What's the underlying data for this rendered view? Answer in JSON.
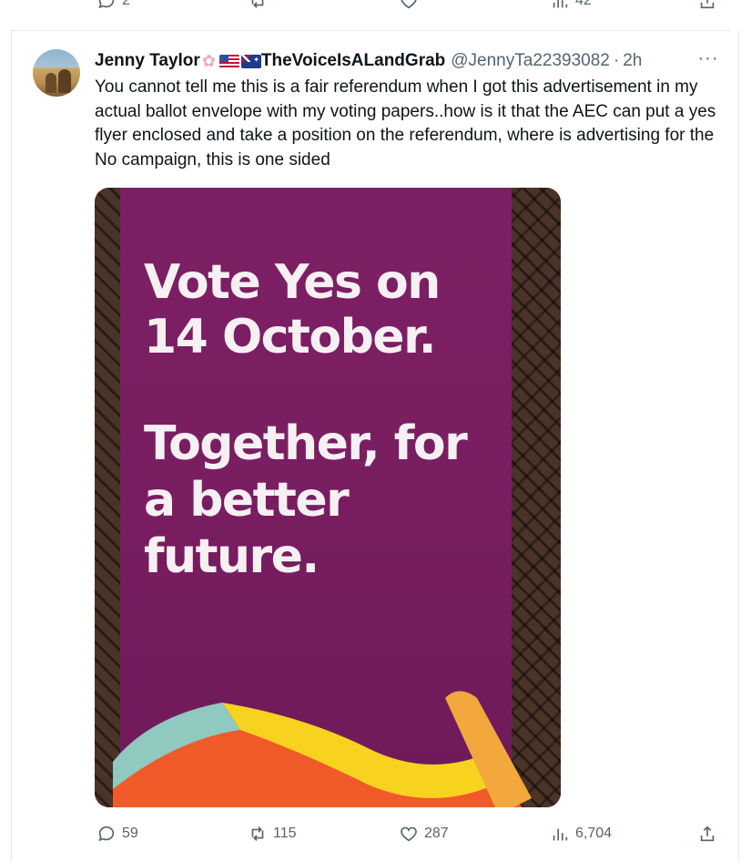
{
  "previous_tweet": {
    "reply_count": "2",
    "views_count": "42"
  },
  "tweet": {
    "author_name": "Jenny Taylor",
    "author_suffix": "TheVoiceIsALandGrab",
    "handle": "@JennyTa22393082",
    "separator": "·",
    "time": "2h",
    "more_label": "···",
    "text": "You cannot tell me this is a fair referendum when I got this advertisement in my actual ballot envelope with my voting papers..how is it that the AEC can put a yes flyer enclosed and take a position on the referendum, where is advertising for the No campaign, this is one sided",
    "media": {
      "headline": "Vote Yes on 14 October.",
      "tagline": "Together, for a better future.",
      "flyer_color": "#7d1f64"
    },
    "stats": {
      "replies": "59",
      "reposts": "115",
      "likes": "287",
      "views": "6,704"
    }
  },
  "icons": {
    "reply": "reply-icon",
    "repost": "repost-icon",
    "like": "heart-icon",
    "views": "views-icon",
    "share": "share-icon"
  },
  "colors": {
    "secondary_text": "#536471",
    "primary_text": "#0f1419",
    "divider": "#e6e9eb"
  }
}
